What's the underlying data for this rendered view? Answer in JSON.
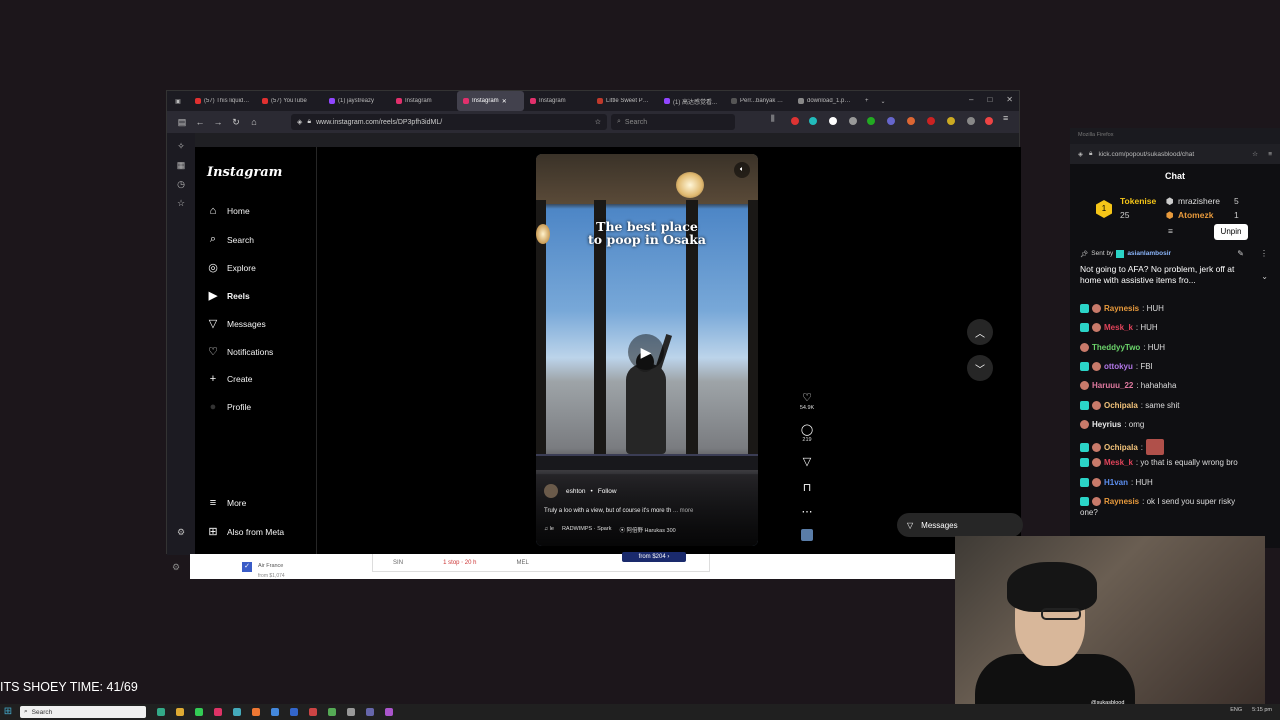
{
  "browser": {
    "tabs": [
      {
        "label": "(57) This liquid is...",
        "color": "#e03030"
      },
      {
        "label": "(57) YouTube",
        "color": "#e03030"
      },
      {
        "label": "(1) jaystreazy",
        "color": "#9146ff"
      },
      {
        "label": "Instagram",
        "color": "#e1306c"
      },
      {
        "label": "Instagram",
        "color": "#e1306c",
        "active": true
      },
      {
        "label": "Instagram",
        "color": "#e1306c"
      },
      {
        "label": "Little Sweet Potat...",
        "color": "#c0392b"
      },
      {
        "label": "(1) 高达感觉看...",
        "color": "#9146ff"
      },
      {
        "label": "Perr...banyak wel...",
        "color": "#555555"
      },
      {
        "label": "download_1.png (PNG...",
        "color": "#888888"
      }
    ],
    "url": "www.instagram.com/reels/DP3pfh3idML/",
    "search_placeholder": "Search"
  },
  "instagram": {
    "logo": "Instagram",
    "nav": [
      {
        "label": "Home",
        "icon": "home-icon",
        "glyph": "⌂"
      },
      {
        "label": "Search",
        "icon": "search-icon",
        "glyph": "⌕"
      },
      {
        "label": "Explore",
        "icon": "explore-icon",
        "glyph": "◎"
      },
      {
        "label": "Reels",
        "icon": "reels-icon",
        "glyph": "▶"
      },
      {
        "label": "Messages",
        "icon": "messages-icon",
        "glyph": "▽"
      },
      {
        "label": "Notifications",
        "icon": "heart-icon",
        "glyph": "♡"
      },
      {
        "label": "Create",
        "icon": "plus-icon",
        "glyph": "+"
      },
      {
        "label": "Profile",
        "icon": "avatar-icon",
        "glyph": "●"
      }
    ],
    "more": "More",
    "also_from_meta": "Also from Meta",
    "reel": {
      "title_line1": "The best place",
      "title_line2": "to poop in Osaka",
      "author": "eshton",
      "follow": "Follow",
      "caption": "Truly a loo with a view, but of course it's more th",
      "caption_more": "... more",
      "audio": "RADWIMPS · Spark",
      "location": "阿倍野 Harukas 300",
      "audio_prefix": "le"
    },
    "actions": {
      "likes": "54.9K",
      "comments": "219"
    },
    "messages_button": "Messages"
  },
  "ad": {
    "airline": "Air France",
    "from": "from $1,074",
    "mid": [
      "SIN",
      "1 stop ⋅ 20 h",
      "MEL"
    ],
    "cta": "from $204 ›"
  },
  "chat": {
    "window_title": "Mozilla Firefox",
    "url": "kick.com/popout/sukasblood/chat",
    "title": "Chat",
    "leaderboard": [
      {
        "name": "Tokenise",
        "count": "25"
      },
      {
        "name": "mrazishere",
        "count": "5"
      },
      {
        "name": "Atomezk",
        "count": "1"
      }
    ],
    "unpin": "Unpin",
    "pinned": {
      "sent_by_label": "Sent by",
      "sender": "asianlambosir",
      "text": "Not going to AFA? No problem, jerk off at home with assistive items fro..."
    },
    "messages": [
      {
        "user": "Raynesis",
        "color": "#e89a3c",
        "text": ": HUH",
        "badges": 2
      },
      {
        "user": "Mesk_k",
        "color": "#e0435a",
        "text": ": HUH",
        "badges": 2
      },
      {
        "user": "TheddyyTwo",
        "color": "#6bd46b",
        "text": ": HUH",
        "badges": 1
      },
      {
        "user": "ottokyu",
        "color": "#b277e8",
        "text": ": FBI",
        "badges": 2
      },
      {
        "user": "Haruuu_22",
        "color": "#e07aa0",
        "text": ": hahahaha",
        "badges": 1
      },
      {
        "user": "Ochipala",
        "color": "#f1c27a",
        "text": ": same shit",
        "badges": 2
      },
      {
        "user": "Heyrius",
        "color": "#eaeaea",
        "text": ": omg",
        "badges": 1
      },
      {
        "user": "Ochipala",
        "color": "#f1c27a",
        "text": ":",
        "badges": 2,
        "emote": true
      },
      {
        "user": "Mesk_k",
        "color": "#e0435a",
        "text": ": yo that is equally wrong bro",
        "badges": 2
      },
      {
        "user": "H1van",
        "color": "#5c8ff0",
        "text": ": HUH",
        "badges": 2
      },
      {
        "user": "Raynesis",
        "color": "#e89a3c",
        "text": ": ok I send you super risky",
        "badges": 2
      },
      {
        "user": "",
        "color": "#dddddd",
        "text": "one?",
        "badges": 0
      }
    ]
  },
  "overlay": {
    "shoey": "ITS SHOEY TIME: 41/69",
    "cam_handle": "@sukasblood"
  },
  "taskbar": {
    "search": "Search",
    "lang": "ENG",
    "time": "5:15 pm"
  }
}
